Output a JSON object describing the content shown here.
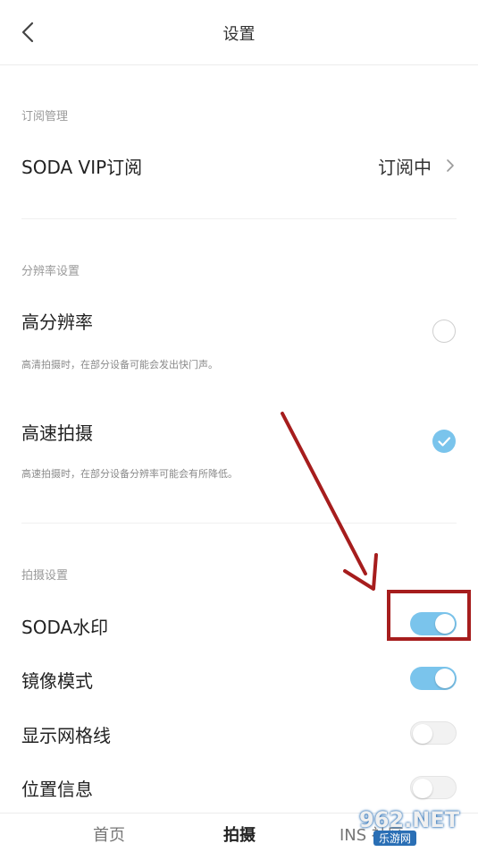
{
  "header": {
    "title": "设置"
  },
  "subscription": {
    "section_label": "订阅管理",
    "vip_label": "SODA VIP订阅",
    "vip_status": "订阅中"
  },
  "resolution": {
    "section_label": "分辨率设置",
    "options": [
      {
        "title": "高分辨率",
        "subtitle": "高清拍摄时，在部分设备可能会发出快门声。",
        "selected": false
      },
      {
        "title": "高速拍摄",
        "subtitle": "高速拍摄时，在部分设备分辨率可能会有所降低。",
        "selected": true
      }
    ]
  },
  "capture": {
    "section_label": "拍摄设置",
    "toggles": [
      {
        "label": "SODA水印",
        "on": true
      },
      {
        "label": "镜像模式",
        "on": true
      },
      {
        "label": "显示网格线",
        "on": false
      },
      {
        "label": "位置信息",
        "on": false
      }
    ]
  },
  "tabs": [
    {
      "label": "首页",
      "active": false
    },
    {
      "label": "拍摄",
      "active": true
    },
    {
      "label": "INS 社区",
      "active": false
    }
  ],
  "watermark": {
    "text": "962.NET",
    "sub": "乐游网"
  },
  "colors": {
    "accent": "#7ac4ec",
    "annotation": "#a61d1d"
  }
}
